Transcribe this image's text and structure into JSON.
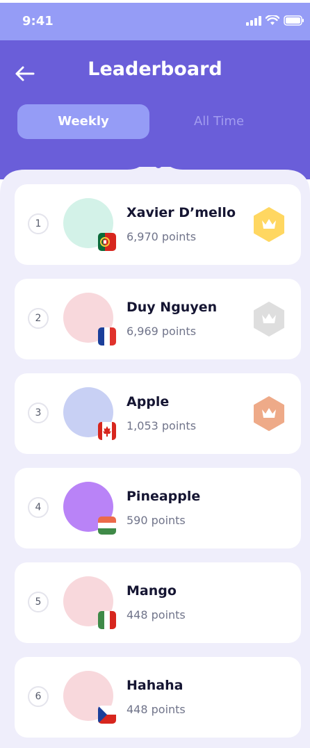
{
  "status_bar": {
    "time": "9:41"
  },
  "header": {
    "title": "Leaderboard",
    "tabs": [
      {
        "label": "Weekly",
        "active": true
      },
      {
        "label": "All Time",
        "active": false
      }
    ]
  },
  "colors": {
    "header_bg": "#6a5ed9",
    "status_bg": "#959cf6",
    "active_tab": "#959cf6",
    "panel_bg": "#efeefb",
    "gold": "#ffd761",
    "silver": "#dedede",
    "bronze": "#eeaa88"
  },
  "leaderboard": [
    {
      "rank": "1",
      "name": "Xavier D’mello",
      "points": "6,970 points",
      "avatar_color": "#d3f2e8",
      "flag": "portugal-flag-icon",
      "medal": "gold"
    },
    {
      "rank": "2",
      "name": "Duy Nguyen",
      "points": "6,969 points",
      "avatar_color": "#f8d8dc",
      "flag": "france-flag-icon",
      "medal": "silver"
    },
    {
      "rank": "3",
      "name": "Apple",
      "points": "1,053 points",
      "avatar_color": "#c8d0f4",
      "flag": "canada-flag-icon",
      "medal": "bronze"
    },
    {
      "rank": "4",
      "name": "Pineapple",
      "points": "590 points",
      "avatar_color": "#b983f7",
      "flag": "hungary-flag-icon",
      "medal": ""
    },
    {
      "rank": "5",
      "name": "Mango",
      "points": "448 points",
      "avatar_color": "#f8d8dc",
      "flag": "italy-flag-icon",
      "medal": ""
    },
    {
      "rank": "6",
      "name": "Hahaha",
      "points": "448 points",
      "avatar_color": "#f8d8dc",
      "flag": "czech-flag-icon",
      "medal": ""
    }
  ]
}
